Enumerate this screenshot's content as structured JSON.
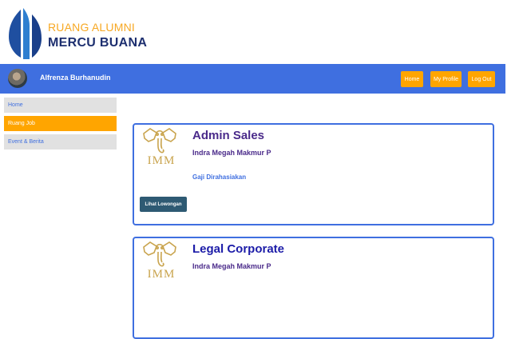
{
  "brand": {
    "line1": "RUANG ALUMNI",
    "line2": "MERCU BUANA"
  },
  "navbar": {
    "username": "Alfrenza Burhanudin",
    "buttons": [
      "Home",
      "My Profile",
      "Log Out"
    ]
  },
  "sidebar": {
    "items": [
      {
        "label": "Home",
        "active": false
      },
      {
        "label": "Ruang Job",
        "active": true
      },
      {
        "label": "Event & Berita",
        "active": false
      }
    ]
  },
  "jobs": [
    {
      "logo_text": "IMM",
      "title": "Admin Sales",
      "company": "Indra Megah Makmur P",
      "salary": "Gaji Dirahasiakan",
      "button": "Lihat Lowongan"
    },
    {
      "logo_text": "IMM",
      "title": "Legal Corporate",
      "company": "Indra Megah Makmur P"
    }
  ],
  "colors": {
    "navbar": "#3f6fe0",
    "accent": "#ffa500",
    "sidebar_bg": "#e1e1e1",
    "button_dark": "#2e5a73",
    "logo_gold": "#c9a44e"
  }
}
